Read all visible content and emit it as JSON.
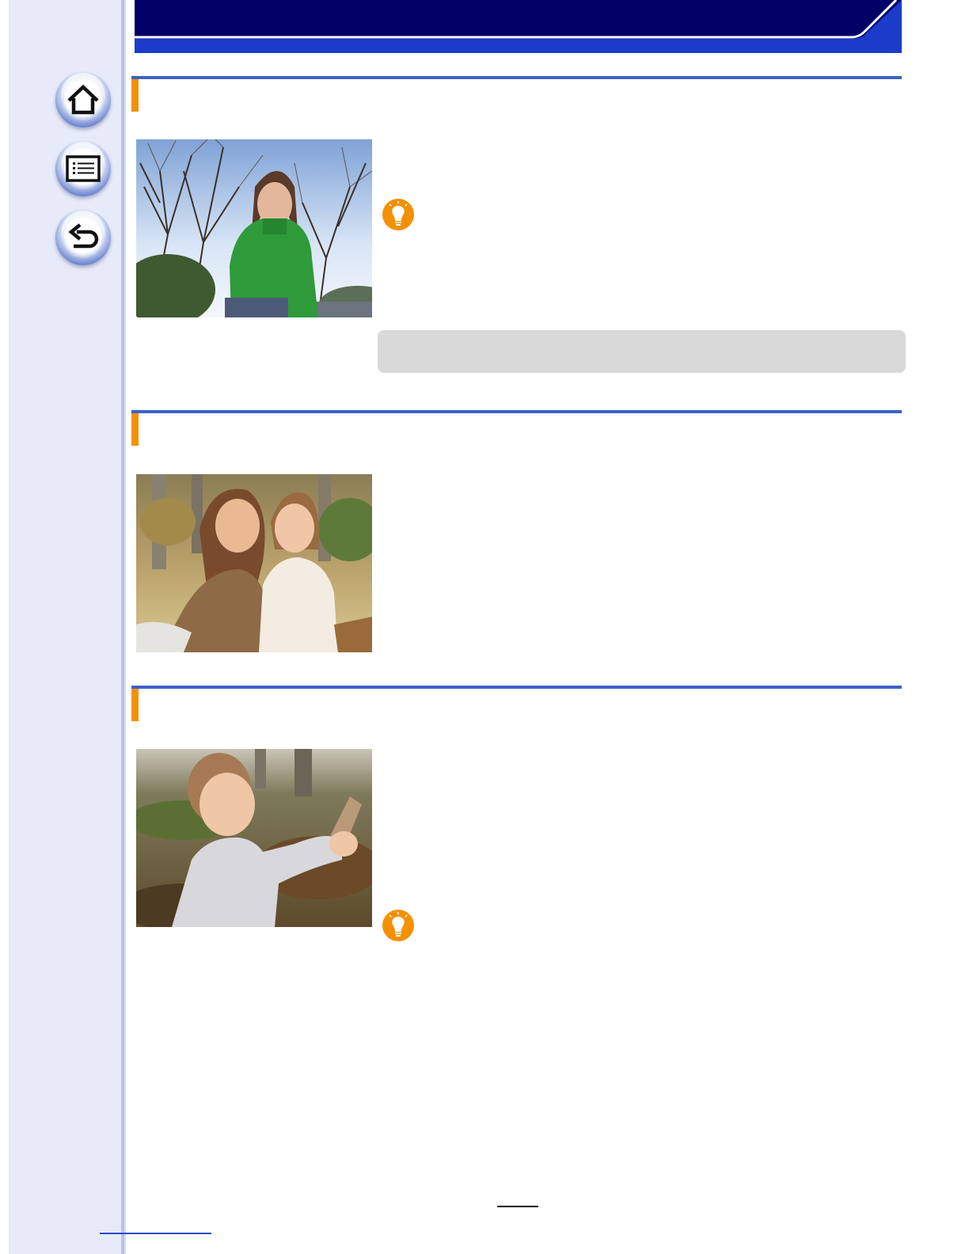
{
  "nav": {
    "home_icon": "home-icon",
    "contents_icon": "list-icon",
    "back_icon": "back-arrow-icon"
  },
  "colors": {
    "header_dark": "#000066",
    "header_blue": "#1a3cc9",
    "section_rule": "#3d61c8",
    "section_accent": "#f39100",
    "tip_icon": "#f39100",
    "sidebar": "#e7eaf8",
    "note_box": "#d9d9d9"
  },
  "sections": [
    {
      "photo": "woman-in-green-sweater-photo",
      "tip_icon": "lightbulb-icon"
    },
    {
      "photo": "two-girls-in-park-photo"
    },
    {
      "photo": "toddler-in-park-photo",
      "tip_icon": "lightbulb-icon"
    }
  ]
}
